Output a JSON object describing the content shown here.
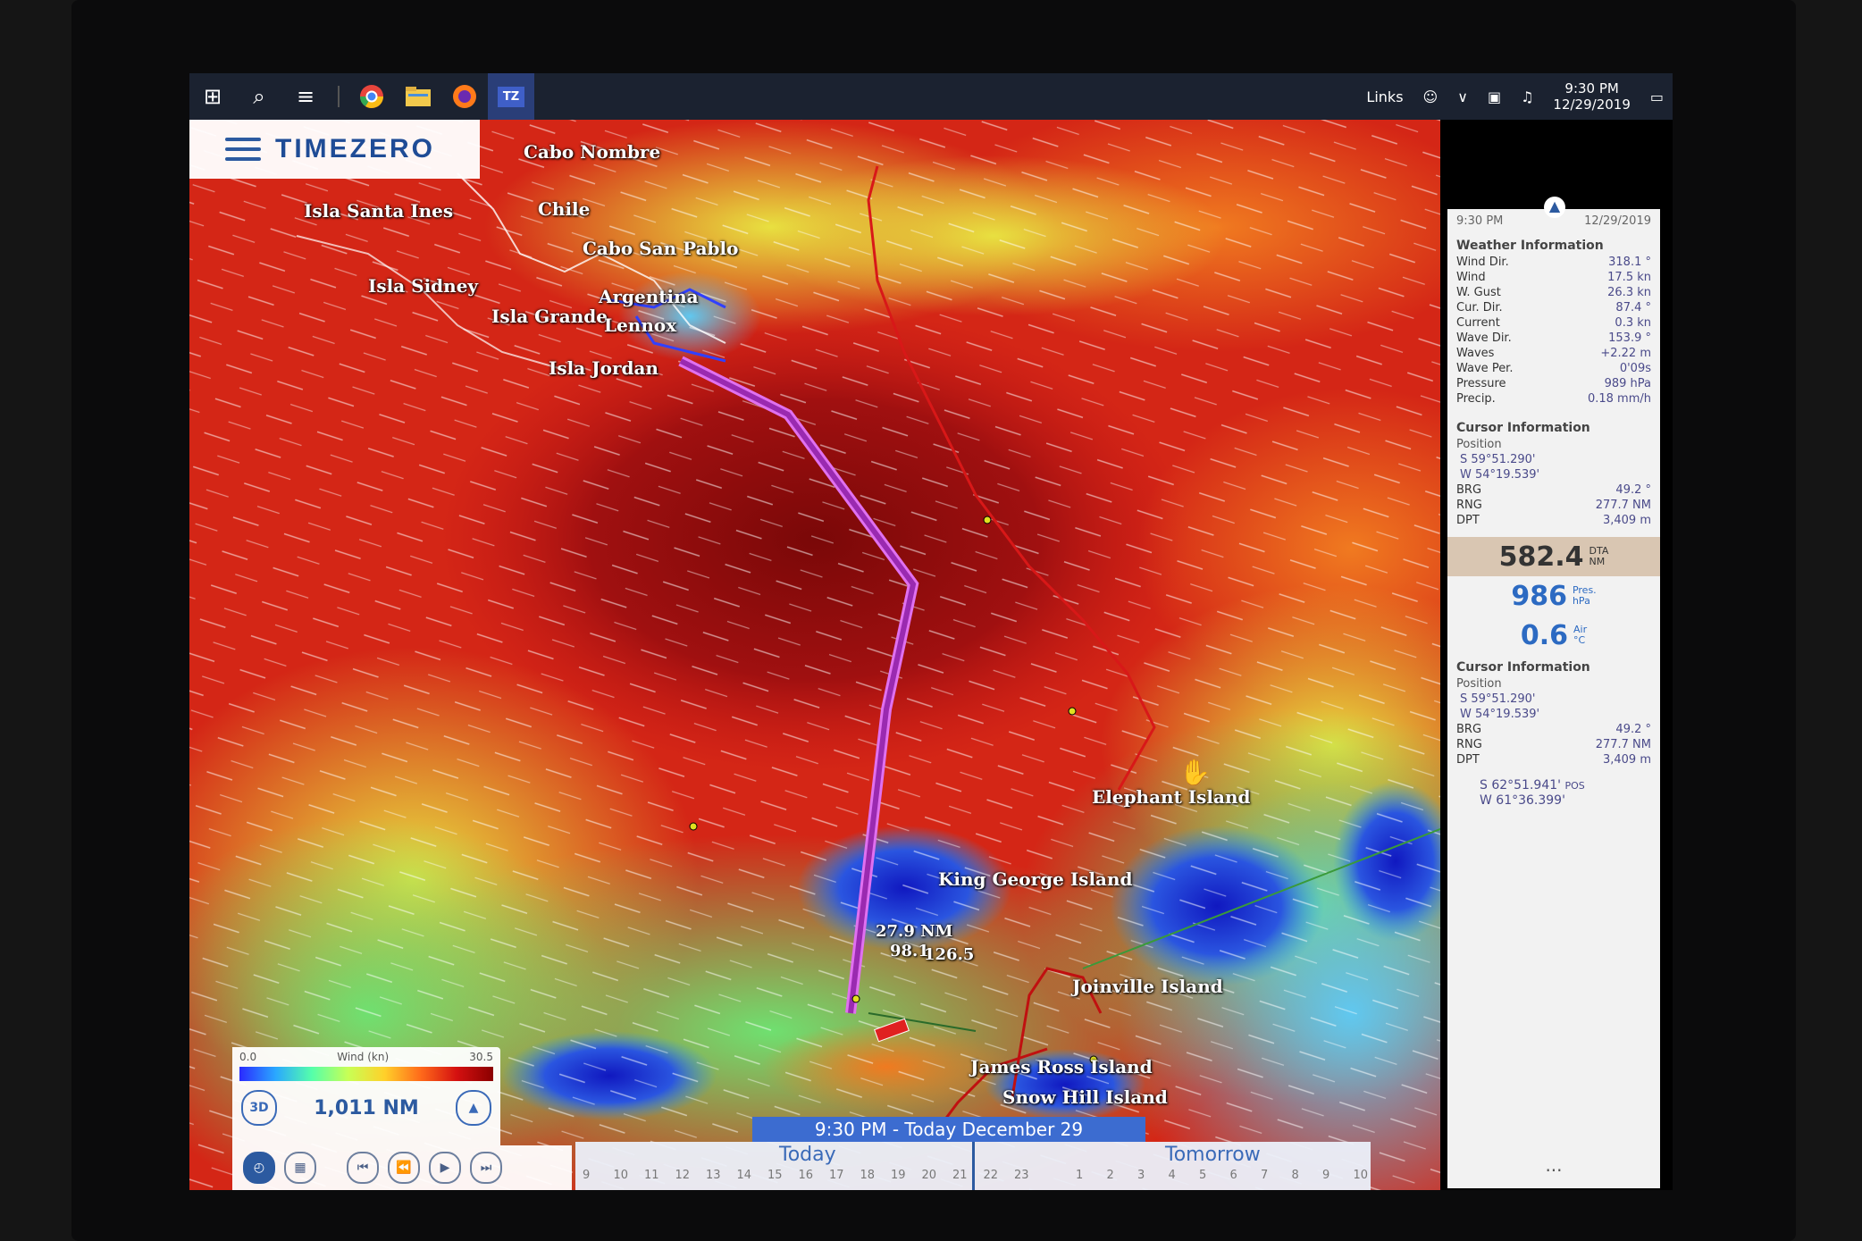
{
  "taskbar": {
    "links_label": "Links",
    "time": "9:30 PM",
    "date": "12/29/2019"
  },
  "app": {
    "name": "TIMEZERO",
    "tab_label": "TZ"
  },
  "map": {
    "places": [
      {
        "label": "Cabo Nombre"
      },
      {
        "label": "Chile"
      },
      {
        "label": "Isla Santa Ines"
      },
      {
        "label": "Cabo San Pablo"
      },
      {
        "label": "Isla Sidney"
      },
      {
        "label": "Argentina"
      },
      {
        "label": "Isla Grande"
      },
      {
        "label": "Lennox"
      },
      {
        "label": "Isla Jordan"
      },
      {
        "label": "Elephant Island"
      },
      {
        "label": "King George Island"
      },
      {
        "label": "Joinville Island"
      },
      {
        "label": "James Ross Island"
      },
      {
        "label": "Snow Hill Island"
      }
    ],
    "route_label_1": "27.9 NM",
    "route_label_2": "98.1",
    "route_label_3": "126.5"
  },
  "panel": {
    "time": "9:30 PM",
    "date": "12/29/2019",
    "weather_title": "Weather Information",
    "weather": [
      {
        "label": "Wind Dir.",
        "value": "318.1 °"
      },
      {
        "label": "Wind",
        "value": "17.5 kn"
      },
      {
        "label": "W. Gust",
        "value": "26.3 kn"
      },
      {
        "label": "Cur. Dir.",
        "value": "87.4 °"
      },
      {
        "label": "Current",
        "value": "0.3 kn"
      },
      {
        "label": "Wave Dir.",
        "value": "153.9 °"
      },
      {
        "label": "Waves",
        "value": "+2.22 m"
      },
      {
        "label": "Wave Per.",
        "value": "0'09s"
      },
      {
        "label": "Pressure",
        "value": "989 hPa"
      },
      {
        "label": "Precip.",
        "value": "0.18 mm/h"
      }
    ],
    "cursor1": {
      "title": "Cursor Information",
      "position_label": "Position",
      "lat": "S 59°51.290'",
      "lon": "W 54°19.539'",
      "rows": [
        {
          "label": "BRG",
          "value": "49.2 °"
        },
        {
          "label": "RNG",
          "value": "277.7 NM"
        },
        {
          "label": "DPT",
          "value": "3,409 m"
        }
      ]
    },
    "dta": {
      "value": "582.4",
      "label": "DTA",
      "unit": "NM"
    },
    "pres": {
      "value": "986",
      "label": "Pres.",
      "unit": "hPa"
    },
    "air": {
      "value": "0.6",
      "label": "Air",
      "unit": "°C"
    },
    "cursor2": {
      "title": "Cursor Information",
      "position_label": "Position",
      "lat": "S 59°51.290'",
      "lon": "W 54°19.539'",
      "rows": [
        {
          "label": "BRG",
          "value": "49.2 °"
        },
        {
          "label": "RNG",
          "value": "277.7 NM"
        },
        {
          "label": "DPT",
          "value": "3,409 m"
        }
      ]
    },
    "pos": {
      "lat": "S 62°51.941'",
      "lon": "W 61°36.399'",
      "label": "POS"
    },
    "more": "..."
  },
  "legend": {
    "min": "0.0",
    "title": "Wind (kn)",
    "max": "30.5",
    "mode_3d": "3D",
    "distance": "1,011 NM"
  },
  "timeline": {
    "banner": "9:30 PM - Today December 29",
    "today": "Today",
    "tomorrow": "Tomorrow",
    "hours": [
      "9",
      "10",
      "11",
      "12",
      "13",
      "14",
      "15",
      "16",
      "17",
      "18",
      "19",
      "20",
      "21",
      "22",
      "23",
      "",
      "1",
      "2",
      "3",
      "4",
      "5",
      "6",
      "7",
      "8",
      "9",
      "10"
    ]
  },
  "colors": {
    "route": "#c050e0",
    "track": "#e02020",
    "accent": "#2c5aa0"
  }
}
